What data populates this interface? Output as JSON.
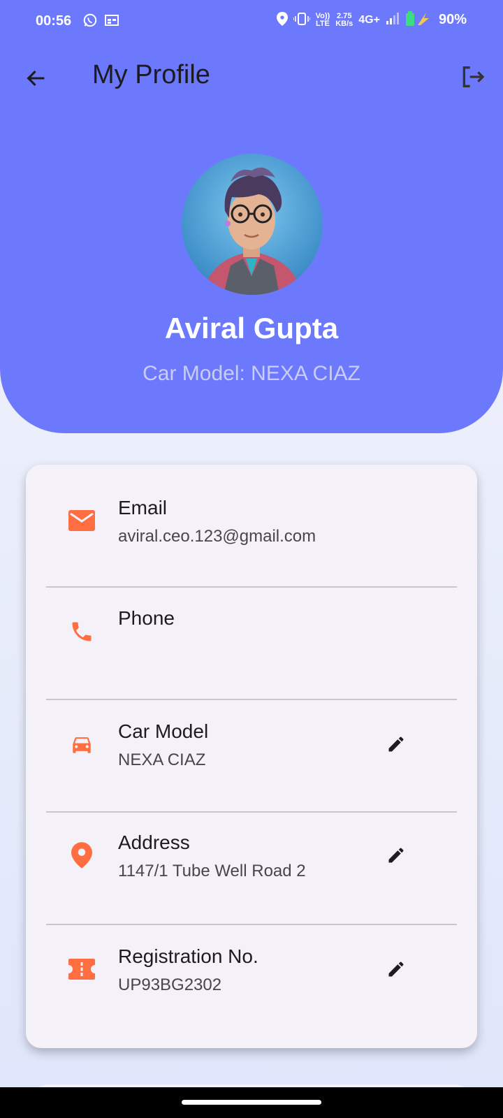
{
  "status_bar": {
    "time": "00:56",
    "speed_value": "2.75",
    "speed_unit": "KB/s",
    "network": "4G+",
    "volte_top": "Vo))",
    "volte_bottom": "LTE",
    "battery": "90%"
  },
  "appbar": {
    "title": "My Profile",
    "back_icon": "arrow-left-icon",
    "logout_icon": "logout-icon"
  },
  "profile": {
    "name": "Aviral Gupta",
    "subtitle": "Car Model: NEXA CIAZ"
  },
  "details": [
    {
      "label": "Email",
      "value": "aviral.ceo.123@gmail.com",
      "icon": "email-icon",
      "editable": false
    },
    {
      "label": "Phone",
      "value": "",
      "icon": "phone-icon",
      "editable": false
    },
    {
      "label": "Car Model",
      "value": "NEXA CIAZ",
      "icon": "car-icon",
      "editable": true
    },
    {
      "label": "Address",
      "value": "1147/1 Tube Well Road 2",
      "icon": "location-pin-icon",
      "editable": true
    },
    {
      "label": "Registration No.",
      "value": "UP93BG2302",
      "icon": "ticket-icon",
      "editable": true
    }
  ],
  "colors": {
    "header": "#6c79fc",
    "accent_icon": "#ff6e40",
    "card": "#f5f1f9"
  }
}
